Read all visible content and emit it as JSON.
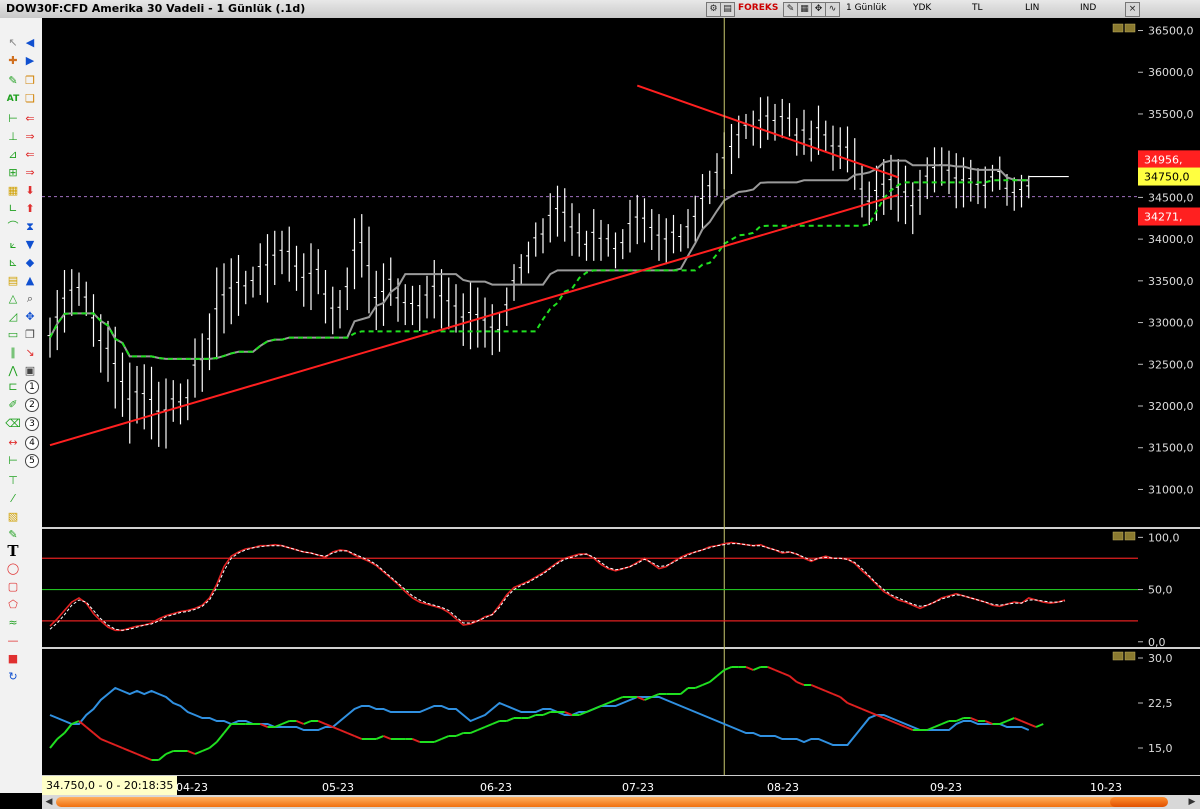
{
  "window": {
    "title": "DOW30F:CFD Amerika 30 Vadeli - 1 Günlük (.1d)",
    "toolbar_labels": [
      "FOREKS",
      "1 Günlük",
      "YDK",
      "TL",
      "LIN",
      "IND"
    ],
    "close_label": "×"
  },
  "status": {
    "text": "34.750,0 - 0 - 20:18:35"
  },
  "tools": {
    "text_tool": "T",
    "numbers": [
      "1",
      "2",
      "3",
      "4",
      "5"
    ]
  },
  "colors": {
    "background": "#000000",
    "candles": "#ffffff",
    "trend_lines": "#ff2020",
    "support_dashed": "#20e020",
    "moving_average": "#9a9a9a",
    "cursor_line": "#c8c870",
    "level_line": "#ff6060",
    "stoch_main": "#e02020",
    "stoch_signal": "#ffffff",
    "adx_blue": "#3090e0",
    "di_green": "#20e020",
    "di_red": "#e02020",
    "axis_label_yellow": "#ffff40"
  },
  "chart_data": [
    {
      "type": "bar",
      "panel": "price",
      "yticks": [
        "36500,0",
        "36000,0",
        "35500,0",
        "35000,0",
        "34500,0",
        "34000,0",
        "33500,0",
        "33000,0",
        "32500,0",
        "32000,0",
        "31500,0",
        "31000,0"
      ],
      "ylim": [
        30550,
        36650
      ],
      "price_labels": [
        {
          "text": "34956,",
          "value": 34956,
          "color": "#ff2020"
        },
        {
          "text": "34750,0",
          "value": 34750,
          "color": "#ffff40"
        },
        {
          "text": "34271,",
          "value": 34271,
          "color": "#ff2020"
        }
      ],
      "x_labels": [
        "04-23",
        "05-23",
        "06-23",
        "07-23",
        "08-23",
        "09-23",
        "10-23"
      ],
      "dashed_level": 34510,
      "trend_upper": {
        "from": [
          81,
          35840
        ],
        "to": [
          117,
          34740
        ]
      },
      "trend_lower": {
        "from": [
          0,
          31530
        ],
        "to": [
          117,
          34530
        ]
      },
      "highs": [
        33060,
        33390,
        33630,
        33640,
        33600,
        33490,
        33340,
        33100,
        33020,
        32950,
        32640,
        32520,
        32480,
        32500,
        32470,
        32290,
        32330,
        32310,
        32270,
        32320,
        32810,
        32870,
        33110,
        33660,
        33710,
        33770,
        33810,
        33620,
        33670,
        33950,
        34060,
        34100,
        34100,
        34150,
        33920,
        33830,
        33950,
        33880,
        33630,
        33430,
        33390,
        33660,
        34250,
        34300,
        34150,
        33620,
        33710,
        33780,
        33530,
        33460,
        33440,
        33450,
        33560,
        33750,
        33640,
        33540,
        33460,
        33350,
        33480,
        33420,
        33300,
        33220,
        33130,
        33420,
        33700,
        33820,
        33970,
        34200,
        34250,
        34550,
        34640,
        34610,
        34430,
        34310,
        34100,
        34360,
        34230,
        34180,
        34080,
        34120,
        34470,
        34530,
        34490,
        34360,
        34300,
        34250,
        34290,
        34180,
        34360,
        34520,
        34780,
        34820,
        35030,
        35280,
        35380,
        35480,
        35500,
        35540,
        35700,
        35710,
        35620,
        35680,
        35630,
        35450,
        35550,
        35420,
        35600,
        35420,
        35360,
        35340,
        35350,
        35210,
        34880,
        34690,
        34880,
        34960,
        35010,
        34960,
        34880,
        34680,
        34830,
        34980,
        35100,
        35100,
        35060,
        35030,
        34980,
        34950,
        34850,
        34870,
        34890,
        34990,
        34780,
        34740,
        34770,
        34760
      ],
      "lows": [
        32580,
        32670,
        32880,
        33080,
        33200,
        33080,
        32710,
        32400,
        32290,
        31970,
        31870,
        31550,
        31790,
        31720,
        31600,
        31510,
        31490,
        31810,
        31780,
        31830,
        32100,
        32170,
        32430,
        32560,
        32870,
        32980,
        33080,
        33220,
        33300,
        33330,
        33240,
        33450,
        33580,
        33490,
        33380,
        33190,
        33150,
        33340,
        32990,
        32860,
        32930,
        33150,
        33400,
        33540,
        33110,
        32910,
        32960,
        33200,
        33010,
        32970,
        32970,
        32900,
        33050,
        33050,
        32930,
        32920,
        32880,
        32720,
        32680,
        32700,
        32700,
        32610,
        32650,
        32960,
        33260,
        33460,
        33590,
        33790,
        33830,
        33960,
        34030,
        33970,
        33800,
        33790,
        33740,
        33740,
        33740,
        33790,
        33650,
        33760,
        33840,
        33940,
        33960,
        33870,
        33740,
        33700,
        33830,
        33850,
        33890,
        33970,
        34130,
        34420,
        34520,
        34600,
        34780,
        34970,
        35200,
        35120,
        35090,
        35190,
        35180,
        35210,
        35230,
        35000,
        35010,
        34930,
        35010,
        35040,
        34820,
        34840,
        34800,
        34590,
        34260,
        34170,
        34220,
        34290,
        34350,
        34210,
        34180,
        34060,
        34290,
        34480,
        34560,
        34640,
        34540,
        34370,
        34380,
        34450,
        34420,
        34370,
        34570,
        34590,
        34400,
        34340,
        34380,
        34490
      ]
    },
    {
      "type": "line",
      "panel": "oscillator",
      "yticks": [
        "100,0",
        "50,0",
        "0,0"
      ],
      "ylim": [
        -5,
        108
      ],
      "levels": [
        80,
        50,
        20
      ],
      "series": [
        {
          "values": [
            15,
            22,
            30,
            38,
            42,
            37,
            27,
            20,
            14,
            11,
            11,
            13,
            15,
            16,
            18,
            22,
            25,
            27,
            29,
            30,
            32,
            35,
            42,
            55,
            72,
            82,
            86,
            89,
            90,
            92,
            92,
            93,
            92,
            90,
            88,
            86,
            85,
            83,
            81,
            86,
            88,
            87,
            83,
            80,
            77,
            73,
            67,
            61,
            55,
            48,
            42,
            38,
            36,
            34,
            32,
            28,
            22,
            16,
            17,
            20,
            24,
            26,
            35,
            45,
            52,
            55,
            58,
            62,
            66,
            71,
            76,
            80,
            82,
            84,
            84,
            80,
            74,
            70,
            68,
            70,
            72,
            76,
            80,
            75,
            70,
            72,
            77,
            81,
            84,
            86,
            88,
            91,
            92,
            94,
            95,
            94,
            93,
            92,
            93,
            90,
            88,
            85,
            86,
            84,
            80,
            77,
            80,
            82,
            80,
            80,
            79,
            75,
            68,
            62,
            55,
            48,
            44,
            40,
            38,
            35,
            32,
            35,
            38,
            42,
            44,
            46,
            44,
            42,
            40,
            38,
            35,
            34,
            36,
            38,
            37,
            42,
            40,
            38,
            37,
            38,
            40
          ]
        },
        {
          "values": [
            12,
            18,
            26,
            35,
            40,
            38,
            30,
            22,
            16,
            12,
            11,
            12,
            14,
            16,
            17,
            20,
            24,
            26,
            28,
            29,
            31,
            34,
            40,
            52,
            68,
            80,
            85,
            88,
            90,
            91,
            92,
            92,
            92,
            90,
            88,
            86,
            85,
            83,
            82,
            85,
            87,
            87,
            84,
            81,
            78,
            74,
            68,
            62,
            56,
            50,
            44,
            40,
            37,
            35,
            33,
            30,
            24,
            18,
            18,
            20,
            23,
            26,
            33,
            43,
            50,
            54,
            57,
            61,
            65,
            70,
            75,
            79,
            81,
            83,
            84,
            81,
            76,
            71,
            69,
            70,
            72,
            75,
            79,
            76,
            72,
            73,
            76,
            80,
            83,
            86,
            88,
            90,
            92,
            93,
            94,
            94,
            93,
            92,
            92,
            90,
            88,
            86,
            86,
            84,
            81,
            78,
            80,
            81,
            80,
            80,
            79,
            76,
            70,
            63,
            56,
            50,
            45,
            42,
            39,
            36,
            34,
            35,
            38,
            41,
            43,
            45,
            44,
            42,
            40,
            38,
            36,
            35,
            36,
            37,
            37,
            40,
            40,
            39,
            38,
            38,
            39
          ]
        }
      ]
    },
    {
      "type": "line",
      "panel": "directional",
      "yticks": [
        "30,0",
        "22,5",
        "15,0"
      ],
      "ylim": [
        10.5,
        31.5
      ],
      "series": [
        {
          "values": [
            20.5,
            20,
            19.5,
            19,
            19,
            20.5,
            21.5,
            23,
            24,
            25,
            24.5,
            24,
            24.5,
            24,
            24.5,
            24,
            23.5,
            22.5,
            22,
            21,
            20.5,
            20,
            20,
            19.5,
            19.5,
            19,
            19.5,
            19.5,
            19,
            19,
            19,
            18.5,
            18.5,
            18.5,
            18.5,
            18,
            18,
            18,
            18.5,
            18.5,
            19.5,
            20.5,
            21.5,
            22,
            22,
            21.5,
            21.5,
            21,
            21,
            21,
            21,
            21,
            21.5,
            22,
            22,
            21.5,
            21.5,
            20.5,
            19.5,
            20,
            20.5,
            21.5,
            22.5,
            22,
            21.5,
            21,
            21,
            21,
            21.5,
            21.5,
            21,
            20.5,
            20.5,
            21,
            21,
            21.5,
            22,
            22,
            22,
            22.5,
            23,
            23.5,
            23.5,
            23.5,
            23.5,
            23,
            22.5,
            22,
            21.5,
            21,
            20.5,
            20,
            19.5,
            19,
            18.5,
            18,
            17.5,
            17.5,
            17,
            17,
            17,
            16.5,
            16.5,
            16.5,
            16,
            16.5,
            16.5,
            16,
            15.5,
            15.5,
            15.5,
            17,
            18.5,
            20,
            20.5,
            20.5,
            20,
            19.5,
            19,
            18.5,
            18,
            18,
            18,
            18,
            18,
            19,
            19.5,
            19.5,
            19,
            19,
            19,
            19,
            18.5,
            18.5,
            18.5,
            18
          ]
        },
        {
          "values": [
            15,
            16.5,
            17.5,
            19,
            19.5,
            18.5,
            17.5,
            16.5,
            16,
            15.5,
            15,
            14.5,
            14,
            13.5,
            13,
            13,
            14,
            14.5,
            14.5,
            14.5,
            14,
            14.5,
            15,
            16,
            17.5,
            19,
            19,
            19,
            19,
            19,
            18.5,
            18.5,
            19,
            19.5,
            19.5,
            19,
            19.5,
            19.5,
            19,
            18.5,
            18,
            17.5,
            17,
            16.5,
            16.5,
            16.5,
            17,
            16.5,
            16.5,
            16.5,
            16.5,
            16,
            16,
            16,
            16.5,
            17,
            17,
            17.5,
            17.5,
            18,
            18.5,
            19,
            19.5,
            19.5,
            20,
            20,
            20,
            20.5,
            20.5,
            21,
            21,
            21,
            20.5,
            20.5,
            21,
            21.5,
            22,
            22.5,
            23,
            23.5,
            23.5,
            23.5,
            23,
            23.5,
            24,
            24,
            24,
            24,
            25,
            25,
            25.5,
            26,
            27,
            28,
            28.5,
            28.5,
            28.5,
            28,
            28.5,
            28.5,
            28,
            27.5,
            27,
            26,
            25.5,
            25.5,
            25,
            24.5,
            24,
            23.5,
            22.5,
            22,
            21.5,
            21,
            20.5,
            20,
            19.5,
            19,
            18.5,
            18,
            18,
            18,
            18.5,
            19,
            19.5,
            19.5,
            20,
            20,
            19.5,
            19.5,
            19,
            19,
            19.5,
            20,
            19.5,
            19,
            18.5,
            19
          ]
        },
        {
          "values": [
            20,
            20,
            19,
            18.5,
            18,
            17.5,
            17,
            16.5,
            16,
            15.5,
            15,
            15,
            14.5,
            14.5,
            14,
            13.5,
            13.5,
            14,
            14.5,
            15,
            15,
            16,
            16.5,
            17.5,
            18.5,
            19,
            19,
            19,
            19,
            19,
            18.5,
            18.5,
            18.5,
            18.5,
            19,
            19,
            19,
            18.5,
            18.5,
            18.5,
            18.5,
            18,
            18,
            17.5,
            17.5,
            17,
            17,
            16.5,
            16.5,
            16.5,
            16.5,
            16.5,
            16.5,
            16.5,
            16.5,
            16.5,
            17,
            17,
            17,
            17.5,
            17.5,
            17.5,
            18,
            18,
            18.5,
            18.5,
            18.5,
            18.5,
            18.5,
            18.5,
            18.5,
            18.5,
            18.5,
            18.5,
            19,
            20,
            20.5,
            20.5,
            20.5,
            20.5,
            20.5,
            21,
            21,
            21,
            21,
            21,
            21,
            20.5,
            21,
            21.5,
            21.5,
            22.5,
            22.5,
            23,
            23,
            23,
            23,
            23,
            23,
            23,
            24,
            24.5,
            24,
            23.5,
            23,
            22,
            21.5,
            21,
            21,
            21,
            21,
            21,
            20.5,
            20.5,
            20,
            20,
            19.5,
            19.5,
            19,
            19,
            19,
            19,
            19,
            19,
            19,
            19.5,
            19.5,
            19.5,
            19.5,
            19,
            19,
            19,
            19,
            19.5,
            19.5,
            19,
            18.5,
            18.5,
            19
          ]
        }
      ]
    }
  ]
}
